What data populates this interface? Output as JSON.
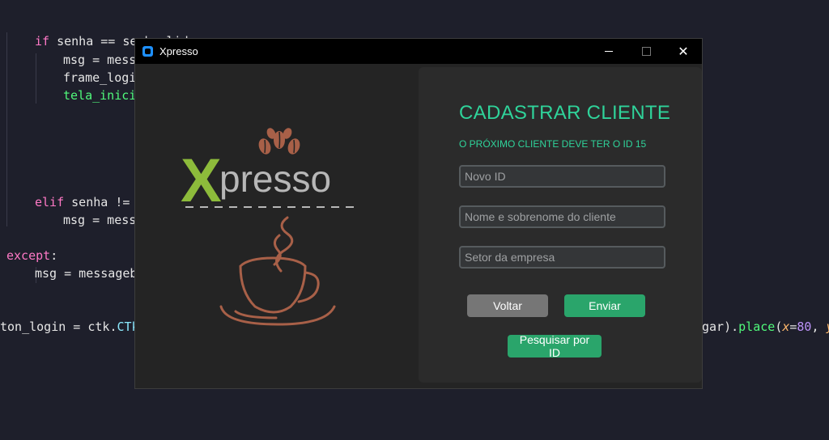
{
  "code": {
    "line1": {
      "kw": "if",
      "rest": " senha == senha_lida:"
    },
    "line2": "msg = mess",
    "line3": "frame_logi",
    "line4": "tela_inici",
    "line5": {
      "kw": "elif",
      "rest": " senha != "
    },
    "line6": "msg = mess",
    "line7": {
      "kw": "except",
      "rest": ":"
    },
    "line8": "msg = messageb",
    "line9_left": {
      "a": "ton_login = ctk.",
      "b": "CTk"
    },
    "line9_right": {
      "a": "gar).",
      "b": "place",
      "c": "(",
      "x": "x",
      "eq": "=",
      "xv": "80",
      "sep": ", ",
      "y": "y",
      "eq2": "="
    }
  },
  "window": {
    "title": "Xpresso",
    "controls": {
      "minimize": "",
      "maximize": "",
      "close": "✕"
    }
  },
  "logo": {
    "x_letter": "X",
    "rest": "presso"
  },
  "form": {
    "title": "CADASTRAR CLIENTE",
    "subtitle": "O PRÓXIMO CLIENTE DEVE TER O ID 15",
    "fields": {
      "id_placeholder": "Novo ID",
      "name_placeholder": "Nome e sobrenome do cliente",
      "sector_placeholder": "Setor da empresa"
    },
    "buttons": {
      "back": "Voltar",
      "send": "Enviar",
      "search": "Pesquisar por ID"
    }
  },
  "colors": {
    "accent": "#2fd39a",
    "button_green": "#2aa56b",
    "button_gray": "#767676",
    "logo_green": "#8dbb3b",
    "logo_brown": "#a86048"
  }
}
